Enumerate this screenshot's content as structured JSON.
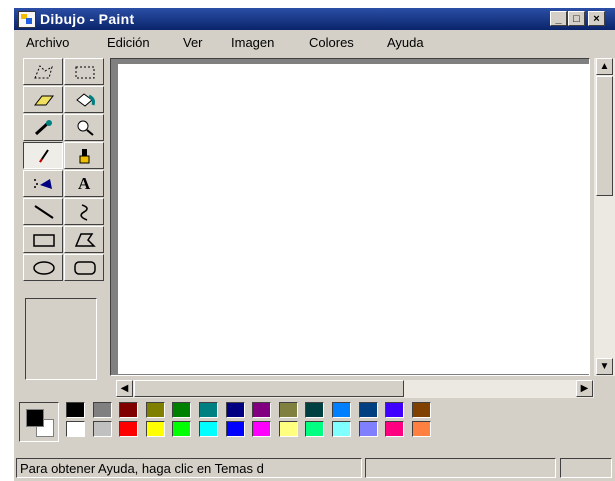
{
  "window": {
    "title": "Dibujo - Paint",
    "min_glyph": "_",
    "max_glyph": "□",
    "close_glyph": "×"
  },
  "menu": [
    "Archivo",
    "Edición",
    "Ver",
    "Imagen",
    "Colores",
    "Ayuda"
  ],
  "tools": [
    {
      "name": "free-form-select",
      "icon": "free-select-icon"
    },
    {
      "name": "select",
      "icon": "rect-select-icon"
    },
    {
      "name": "eraser",
      "icon": "eraser-icon"
    },
    {
      "name": "fill",
      "icon": "fill-bucket-icon"
    },
    {
      "name": "pick-color",
      "icon": "eyedropper-icon"
    },
    {
      "name": "magnifier",
      "icon": "magnifier-icon"
    },
    {
      "name": "pencil",
      "icon": "pencil-icon",
      "selected": true
    },
    {
      "name": "brush",
      "icon": "brush-icon"
    },
    {
      "name": "airbrush",
      "icon": "airbrush-icon"
    },
    {
      "name": "text",
      "icon": "text-icon",
      "glyph": "A"
    },
    {
      "name": "line",
      "icon": "line-icon"
    },
    {
      "name": "curve",
      "icon": "curve-icon"
    },
    {
      "name": "rectangle",
      "icon": "rectangle-icon"
    },
    {
      "name": "polygon",
      "icon": "polygon-icon"
    },
    {
      "name": "ellipse",
      "icon": "ellipse-icon"
    },
    {
      "name": "rounded-rectangle",
      "icon": "rounded-rect-icon"
    }
  ],
  "colors": {
    "foreground": "#000000",
    "background": "#ffffff",
    "palette_top": [
      "#000000",
      "#808080",
      "#800000",
      "#808000",
      "#008000",
      "#008080",
      "#000080",
      "#800080",
      "#808040",
      "#004040",
      "#0080ff",
      "#004080",
      "#4000ff",
      "#804000"
    ],
    "palette_bottom": [
      "#ffffff",
      "#c0c0c0",
      "#ff0000",
      "#ffff00",
      "#00ff00",
      "#00ffff",
      "#0000ff",
      "#ff00ff",
      "#ffff80",
      "#00ff80",
      "#80ffff",
      "#8080ff",
      "#ff0080",
      "#ff8040"
    ]
  },
  "status": {
    "help_text": "Para obtener Ayuda, haga clic en Temas d"
  }
}
